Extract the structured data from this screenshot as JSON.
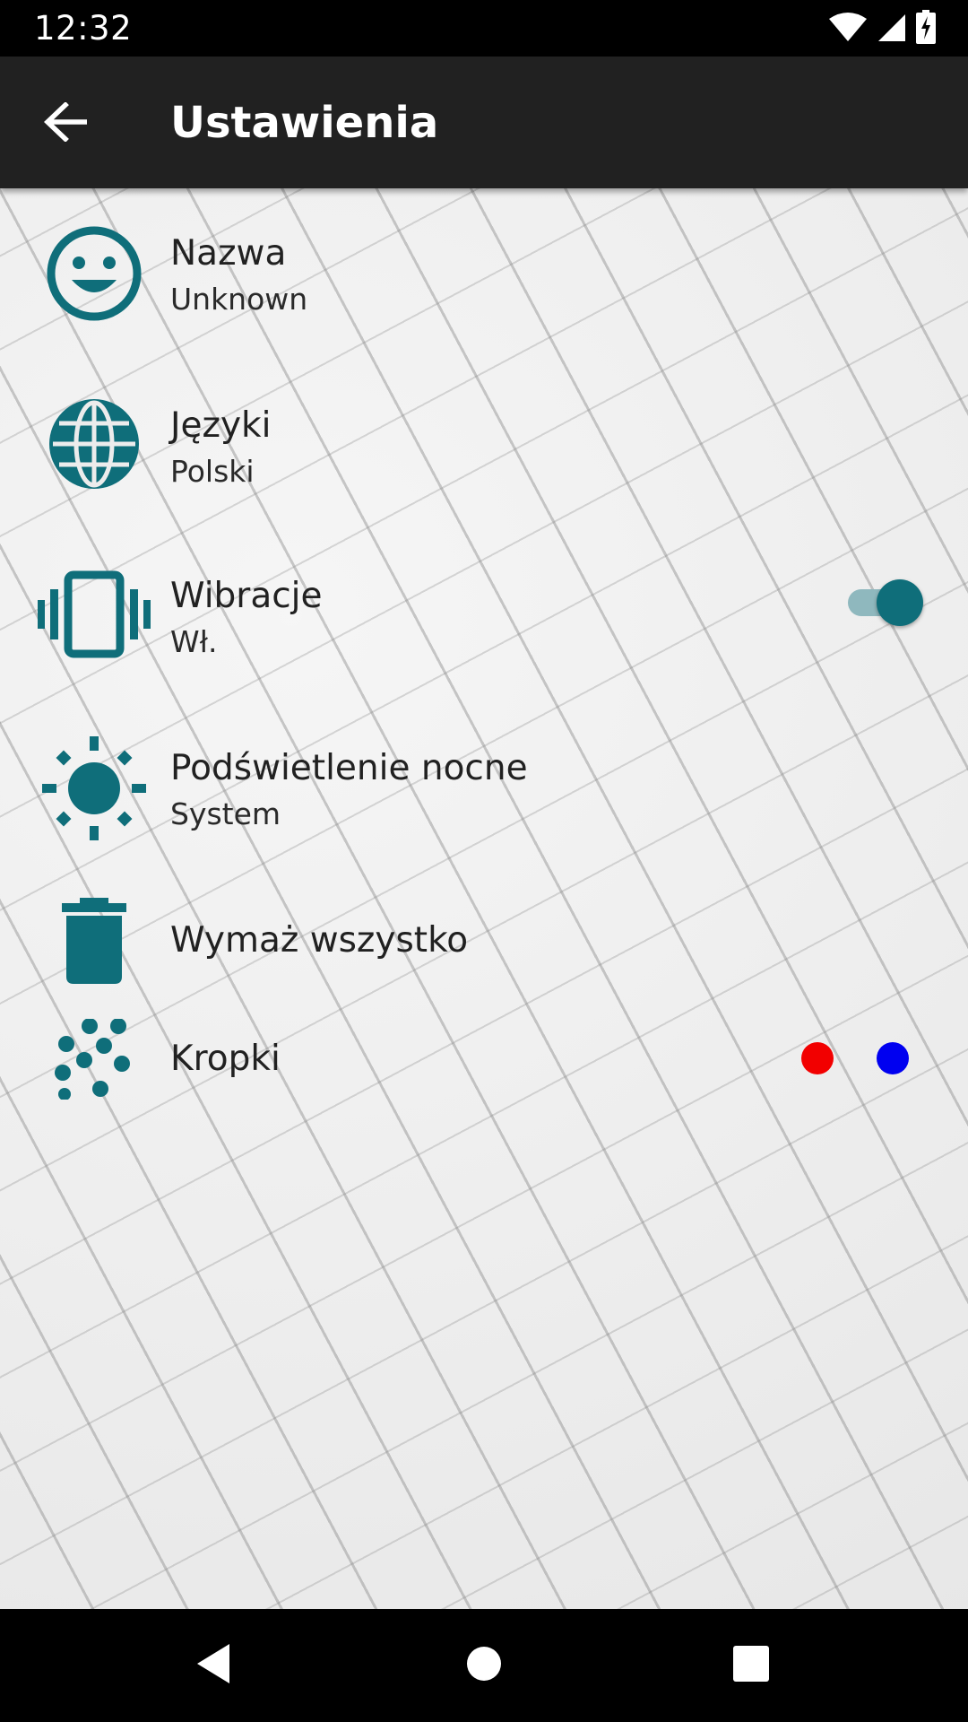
{
  "status_bar": {
    "time": "12:32",
    "icons": [
      "wifi-icon",
      "cell-signal-icon",
      "battery-charging-icon"
    ]
  },
  "app_bar": {
    "title": "Ustawienia",
    "back_icon": "arrow-back-icon"
  },
  "theme": {
    "accent": "#0f6e7a",
    "app_bar_bg": "#212121",
    "switch_track": "#8fb8be"
  },
  "settings": [
    {
      "icon": "smiley-face-icon",
      "title": "Nazwa",
      "subtitle": "Unknown"
    },
    {
      "icon": "globe-icon",
      "title": "Języki",
      "subtitle": "Polski"
    },
    {
      "icon": "vibration-icon",
      "title": "Wibracje",
      "subtitle": "Wł.",
      "toggle": true
    },
    {
      "icon": "brightness-icon",
      "title": "Podświetlenie nocne",
      "subtitle": "System"
    },
    {
      "icon": "trash-icon",
      "title": "Wymaż wszystko"
    },
    {
      "icon": "dots-icon",
      "title": "Kropki",
      "colors": [
        "#f20000",
        "#0000f0"
      ]
    }
  ],
  "nav_bar": {
    "buttons": [
      "back-triangle-icon",
      "home-circle-icon",
      "recents-square-icon"
    ]
  }
}
